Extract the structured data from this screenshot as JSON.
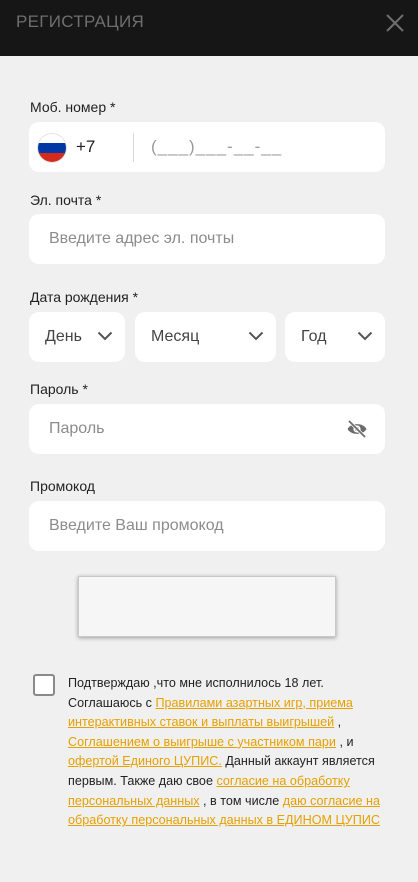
{
  "header": {
    "title": "РЕГИСТРАЦИЯ",
    "close_icon": "close-icon"
  },
  "phone": {
    "label": "Моб. номер *",
    "country_flag": "russia-flag-icon",
    "code": "+7",
    "placeholder": "(___)___-__-__"
  },
  "email": {
    "label": "Эл. почта *",
    "placeholder": "Введите адрес эл. почты"
  },
  "birthdate": {
    "label": "Дата рождения *",
    "day": "День",
    "month": "Месяц",
    "year": "Год"
  },
  "password": {
    "label": "Пароль *",
    "placeholder": "Пароль",
    "toggle_icon": "eye-off-icon"
  },
  "promo": {
    "label": "Промокод",
    "placeholder": "Введите Ваш промокод"
  },
  "consent": {
    "checked": false,
    "t1": "Подтверждаю ,что мне исполнилось 18 лет. Соглашаюсь с ",
    "l1": "Правилами азартных игр, приема интерактивных ставок и выплаты выигрышей",
    "t2": " , ",
    "l2": "Соглашением о выигрыше с участником пари",
    "t3": " , и ",
    "l3": "офертой Единого ЦУПИС.",
    "t4": " Данный аккаунт является первым. Также даю свое ",
    "l4": "согласие на обработку персональных данных",
    "t5": " , в том числе ",
    "l5": "даю согласие на обработку персональных данных в ЕДИНОМ ЦУПИС"
  },
  "colors": {
    "accent": "#e6a100",
    "header_bg": "#161616",
    "panel_bg": "#f0f0f0",
    "field_bg": "#ffffff"
  }
}
